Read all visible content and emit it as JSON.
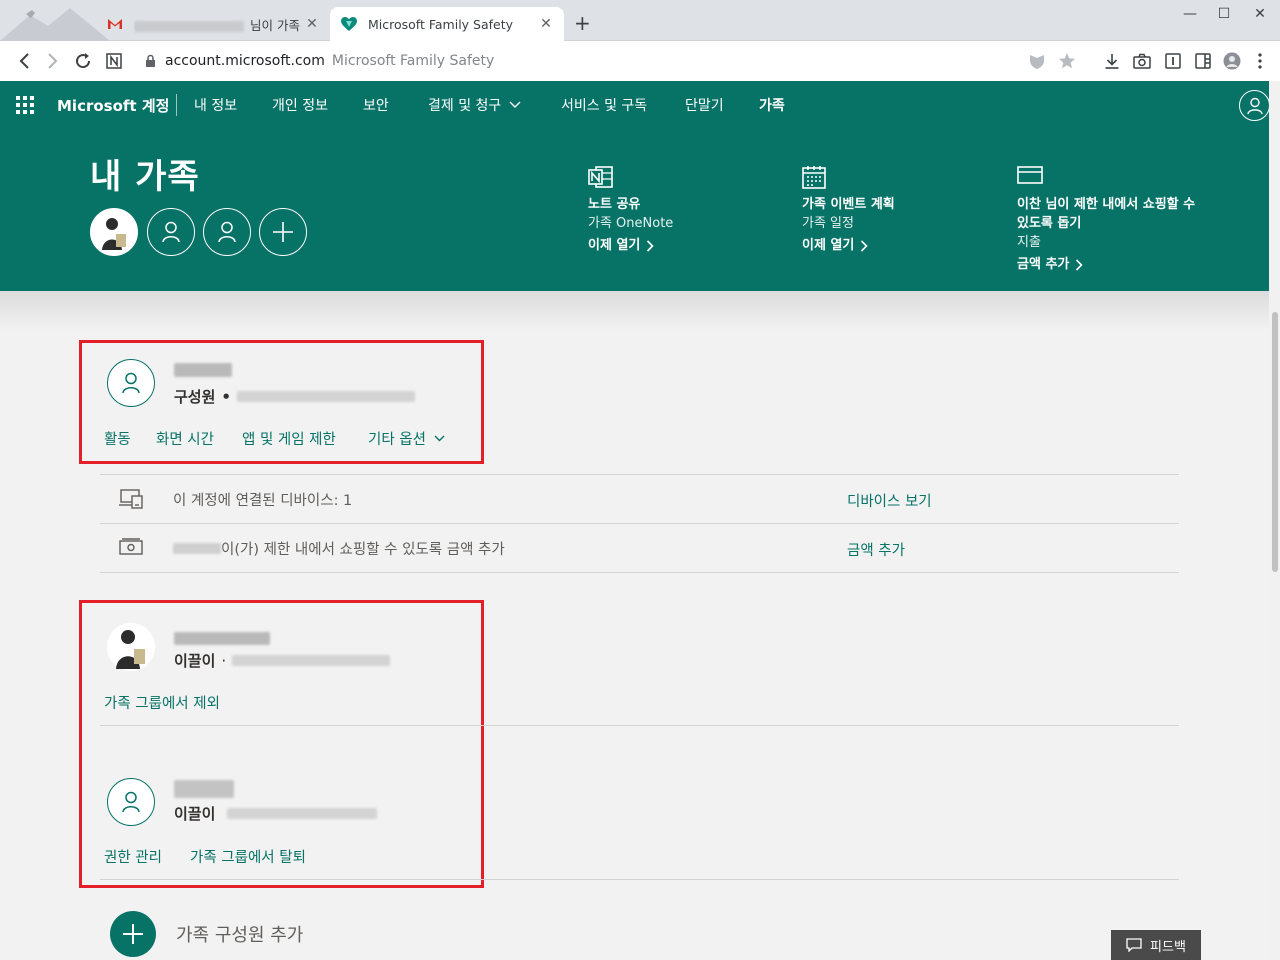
{
  "browser": {
    "tabs": [
      {
        "title_suffix": "님이 가족",
        "icon": "gmail-icon"
      },
      {
        "title": "Microsoft Family Safety",
        "icon": "family-safety-heart-icon"
      }
    ],
    "address": {
      "host": "account.microsoft.com",
      "page_title": "Microsoft Family Safety"
    }
  },
  "header": {
    "brand": "Microsoft 계정",
    "nav": [
      "내 정보",
      "개인 정보",
      "보안",
      "결제 및 청구",
      "서비스 및 구독",
      "단말기",
      "가족"
    ]
  },
  "hero": {
    "title": "내 가족",
    "features": [
      {
        "icon": "onenote-icon",
        "heading": "노트 공유",
        "sub": "가족 OneNote",
        "link": "이제 열기"
      },
      {
        "icon": "calendar-icon",
        "heading": "가족 이벤트 계획",
        "sub": "가족 일정",
        "link": "이제 열기"
      },
      {
        "icon": "card-icon",
        "heading": "이찬 님이 제한 내에서 쇼핑할 수 있도록 돕기",
        "sub": "지출",
        "link": "금액 추가"
      }
    ]
  },
  "members": [
    {
      "role": "구성원",
      "actions": [
        "활동",
        "화면 시간",
        "앱 및 게임 제한",
        "기타 옵션"
      ]
    },
    {
      "role": "이끌이",
      "actions": [
        "가족 그룹에서 제외"
      ]
    },
    {
      "role": "이끌이",
      "actions": [
        "권한 관리",
        "가족 그룹에서 탈퇴"
      ]
    }
  ],
  "info_rows": [
    {
      "text": "이 계정에 연결된 디바이스: 1",
      "link": "디바이스 보기"
    },
    {
      "text": "이(가) 제한 내에서 쇼핑할 수 있도록 금액 추가",
      "link": "금액 추가"
    }
  ],
  "add_member_label": "가족 구성원 추가",
  "feedback_label": "피드백",
  "colors": {
    "brand_green": "#077367",
    "highlight_red": "#e3202a",
    "page_bg": "#f2f2f2"
  }
}
